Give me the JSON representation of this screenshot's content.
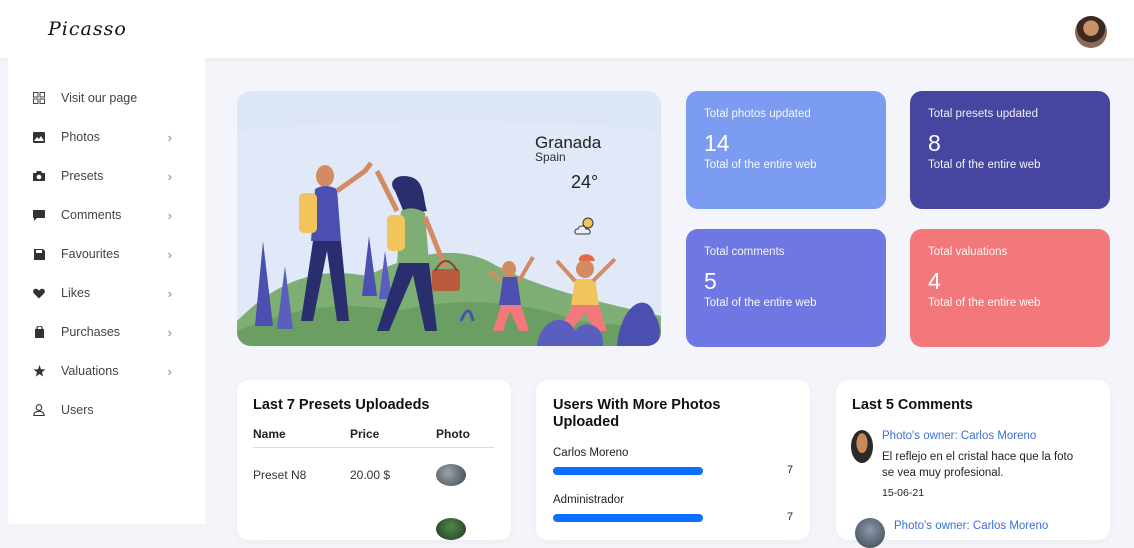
{
  "header": {
    "logo": "Picasso"
  },
  "sidebar": {
    "items": [
      {
        "label": "Visit our page",
        "icon": "grid-icon",
        "has_chevron": false
      },
      {
        "label": "Photos",
        "icon": "image-icon",
        "has_chevron": true
      },
      {
        "label": "Presets",
        "icon": "camera-icon",
        "has_chevron": true
      },
      {
        "label": "Comments",
        "icon": "comment-icon",
        "has_chevron": true
      },
      {
        "label": "Favourites",
        "icon": "save-icon",
        "has_chevron": true
      },
      {
        "label": "Likes",
        "icon": "heart-icon",
        "has_chevron": true
      },
      {
        "label": "Purchases",
        "icon": "bag-icon",
        "has_chevron": true
      },
      {
        "label": "Valuations",
        "icon": "star-icon",
        "has_chevron": true
      },
      {
        "label": "Users",
        "icon": "user-icon",
        "has_chevron": false
      }
    ]
  },
  "weather": {
    "city": "Granada",
    "country": "Spain",
    "temperature": "24°",
    "icon": "partly-cloudy-icon"
  },
  "stats": [
    {
      "title": "Total photos updated",
      "value": "14",
      "subtitle": "Total of the entire web",
      "color": "#7b9cf0"
    },
    {
      "title": "Total presets updated",
      "value": "8",
      "subtitle": "Total of the entire web",
      "color": "#46459f"
    },
    {
      "title": "Total comments",
      "value": "5",
      "subtitle": "Total of the entire web",
      "color": "#6f78e2"
    },
    {
      "title": "Total valuations",
      "value": "4",
      "subtitle": "Total of the entire web",
      "color": "#f2787b"
    }
  ],
  "presets_card": {
    "title": "Last 7 Presets Uploadeds",
    "columns": [
      "Name",
      "Price",
      "Photo"
    ],
    "rows": [
      {
        "name": "Preset N8",
        "price": "20.00 $"
      }
    ]
  },
  "users_card": {
    "title": "Users With More Photos Uploaded",
    "users": [
      {
        "name": "Carlos Moreno",
        "count": "7",
        "progress": 1.0
      },
      {
        "name": "Administrador",
        "count": "7",
        "progress": 1.0
      }
    ]
  },
  "comments_card": {
    "title": "Last 5 Comments",
    "comments": [
      {
        "owner": "Photo's owner: Carlos Moreno",
        "text": "El reflejo en el cristal hace que la foto se vea muy profesional.",
        "date": "15-06-21"
      },
      {
        "owner": "Photo's owner: Carlos Moreno"
      }
    ]
  }
}
